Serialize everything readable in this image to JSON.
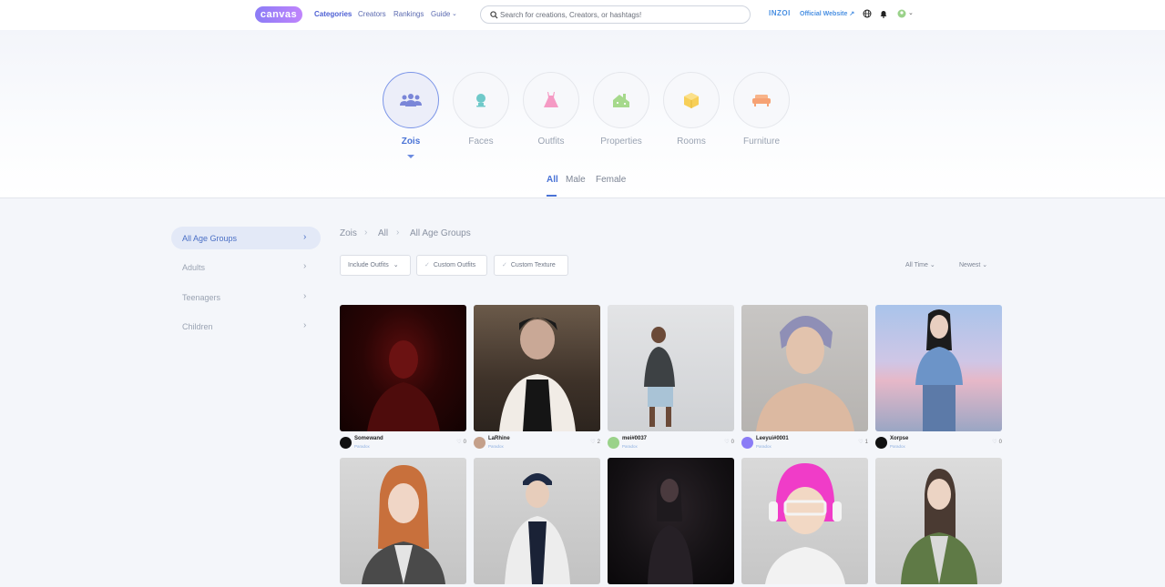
{
  "header": {
    "logo": "canvas",
    "nav": [
      {
        "label": "Categories",
        "active": true
      },
      {
        "label": "Creators",
        "active": false
      },
      {
        "label": "Rankings",
        "active": false
      },
      {
        "label": "Guide",
        "active": false
      }
    ],
    "search_placeholder": "Search for creations, Creators, or hashtags!",
    "brand": "INZOI",
    "official_link": "Official Website ↗"
  },
  "categories": [
    {
      "label": "Zois",
      "icon": "people-group-icon",
      "active": true
    },
    {
      "label": "Faces",
      "icon": "face-icon",
      "active": false
    },
    {
      "label": "Outfits",
      "icon": "dress-icon",
      "active": false
    },
    {
      "label": "Properties",
      "icon": "building-icon",
      "active": false
    },
    {
      "label": "Rooms",
      "icon": "cube-icon",
      "active": false
    },
    {
      "label": "Furniture",
      "icon": "sofa-icon",
      "active": false
    }
  ],
  "subtabs": [
    {
      "label": "All",
      "active": true
    },
    {
      "label": "Male",
      "active": false
    },
    {
      "label": "Female",
      "active": false
    }
  ],
  "sidebar": {
    "items": [
      {
        "label": "All Age Groups",
        "active": true
      },
      {
        "label": "Adults",
        "active": false
      },
      {
        "label": "Teenagers",
        "active": false
      },
      {
        "label": "Children",
        "active": false
      }
    ]
  },
  "breadcrumb": [
    "Zois",
    "All",
    "All Age Groups"
  ],
  "filters": {
    "include_outfits": "Include Outfits",
    "custom_outfits": "Custom Outfits",
    "custom_texture": "Custom Texture",
    "time": "All Time",
    "sort": "Newest"
  },
  "creations": [
    {
      "creator": "Somewand",
      "tag": "Paradox",
      "likes": "0"
    },
    {
      "creator": "LaRhine",
      "tag": "Paradox",
      "likes": "2"
    },
    {
      "creator": "mei#0037",
      "tag": "Paradox",
      "likes": "0"
    },
    {
      "creator": "Leeyui#0001",
      "tag": "Paradox",
      "likes": "1"
    },
    {
      "creator": "Xorpse",
      "tag": "Paradox",
      "likes": "0"
    },
    {
      "creator": "",
      "tag": "",
      "likes": ""
    },
    {
      "creator": "",
      "tag": "",
      "likes": ""
    },
    {
      "creator": "",
      "tag": "",
      "likes": ""
    },
    {
      "creator": "",
      "tag": "",
      "likes": ""
    },
    {
      "creator": "",
      "tag": "",
      "likes": ""
    }
  ],
  "colors": {
    "accent": "#4a73d6",
    "sidebar_active_bg": "#e3e9f7",
    "brand": "#4a90e2"
  }
}
